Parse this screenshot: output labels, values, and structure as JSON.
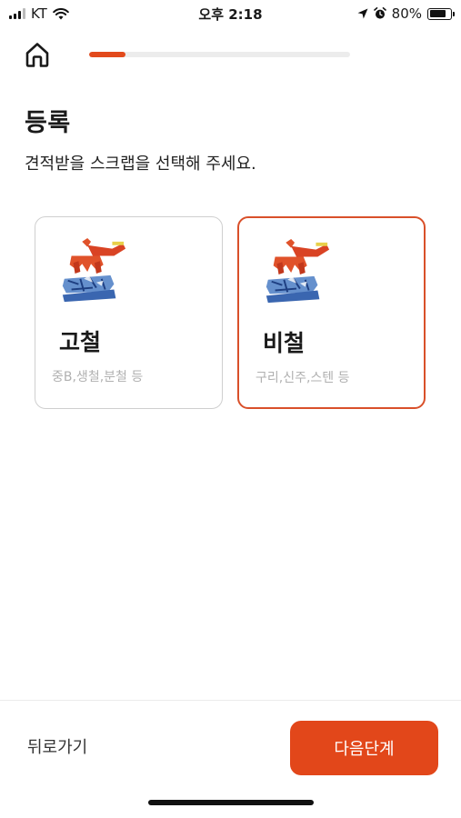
{
  "status_bar": {
    "carrier": "KT",
    "time": "오후 2:18",
    "battery_percent": "80%",
    "battery_level": 0.8
  },
  "header": {
    "home_icon": "home-icon",
    "progress": 0.14
  },
  "page": {
    "title": "등록",
    "subtitle": "견적받을 스크랩을 선택해 주세요."
  },
  "options": [
    {
      "title": "고철",
      "description": "중B,생철,분철 등",
      "icon": "scrap-crane-icon",
      "selected": false
    },
    {
      "title": "비철",
      "description": "구리,신주,스텐 등",
      "icon": "scrap-crane-icon",
      "selected": true
    }
  ],
  "footer": {
    "back_label": "뒤로가기",
    "next_label": "다음단계"
  },
  "colors": {
    "accent": "#E2471A",
    "selected_border": "#D9502A",
    "muted_text": "#B0B0B0"
  }
}
